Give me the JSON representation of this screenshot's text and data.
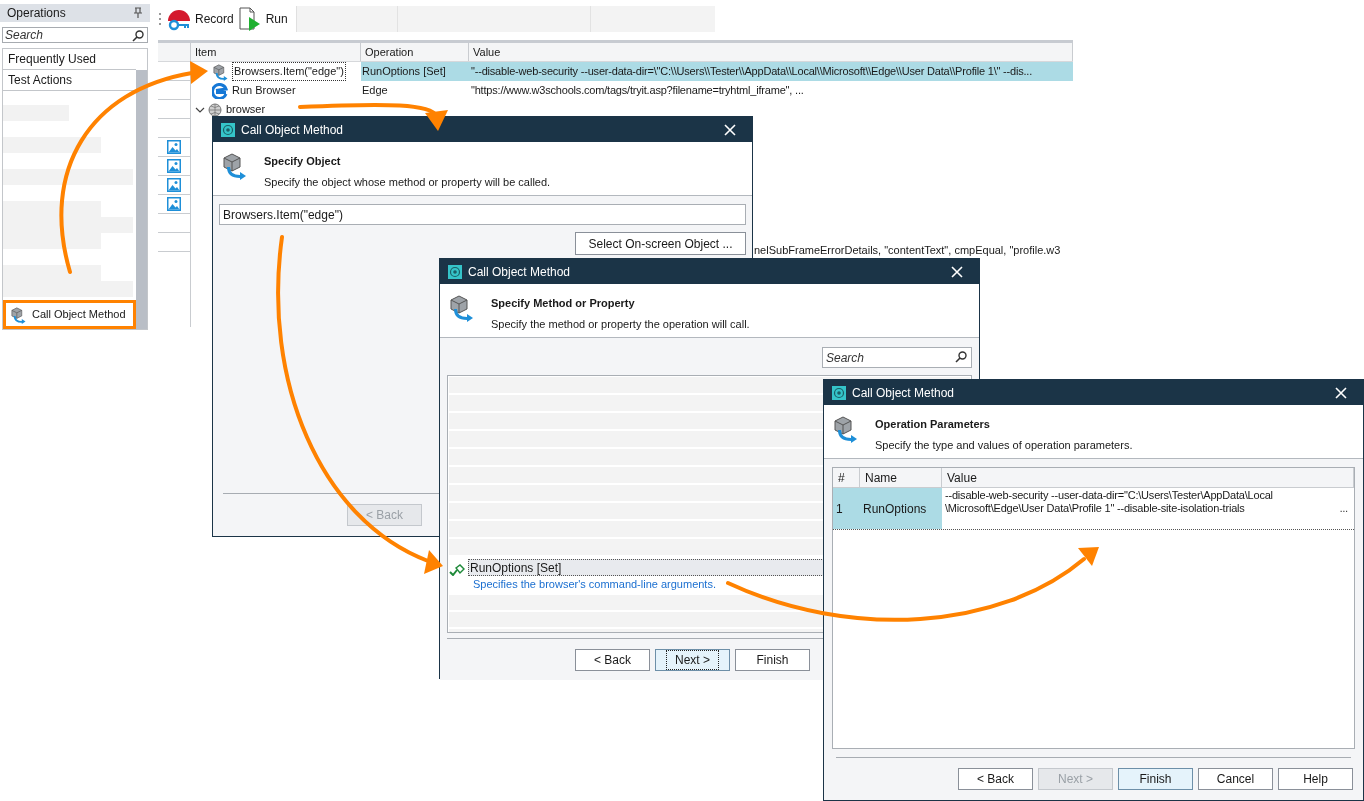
{
  "operations_panel": {
    "title": "Operations",
    "search": {
      "placeholder": "Search"
    },
    "categories": [
      {
        "label": "Frequently Used"
      },
      {
        "label": "Test Actions"
      }
    ],
    "items": [
      {
        "label": "Call Object Method",
        "selected": true
      }
    ]
  },
  "toolbar": {
    "buttons": [
      {
        "label": "Record",
        "kind": "record"
      },
      {
        "label": "Run",
        "kind": "run"
      }
    ]
  },
  "test_grid": {
    "columns": [
      "Item",
      "Operation",
      "Value"
    ],
    "rows": [
      {
        "kind": "object",
        "item": "Browsers.Item(\"edge\")",
        "operation": "RunOptions [Set]",
        "value": "\"--disable-web-security --user-data-dir=\\\"C:\\\\Users\\\\Tester\\\\AppData\\\\Local\\\\Microsoft\\\\Edge\\\\User Data\\\\Profile 1\\\" --dis...",
        "selected": true
      },
      {
        "kind": "edge",
        "item": "Run Browser",
        "operation": "Edge",
        "value": "\"https://www.w3schools.com/tags/tryit.asp?filename=tryhtml_iframe\", ...",
        "selected": false
      },
      {
        "kind": "globe",
        "item": "browser",
        "expanded": true,
        "selected": false
      }
    ],
    "covered_rows": [
      {
        "image": false
      },
      {
        "image": true
      },
      {
        "image": true
      },
      {
        "image": true
      },
      {
        "image": true
      },
      {
        "image": false
      },
      {
        "image": false
      }
    ],
    "cut_off_text": "nelSubFrameErrorDetails, \"contentText\", cmpEqual, \"profile.w3"
  },
  "dialogs": [
    {
      "kind": "specify_object",
      "title": "Call Object Method",
      "step_title": "Specify Object",
      "step_description": "Specify the object whose method or property will be called.",
      "object_value": "Browsers.Item(\"edge\")",
      "pick_button": "Select On-screen Object ...",
      "buttons": [
        {
          "label": "< Back",
          "disabled": true,
          "focused": false
        }
      ]
    },
    {
      "kind": "specify_method",
      "title": "Call Object Method",
      "step_title": "Specify Method or Property",
      "step_description": "Specify the method or property the operation will call.",
      "search": {
        "placeholder": "Search"
      },
      "members": [
        {
          "name": "RunOptions [Set]",
          "description": "Specifies the browser's command-line arguments.",
          "selected": true
        }
      ],
      "buttons": [
        {
          "label": "< Back",
          "disabled": false,
          "focused": false
        },
        {
          "label": "Next >",
          "disabled": false,
          "focused": true
        },
        {
          "label": "Finish",
          "disabled": false,
          "focused": false
        }
      ]
    },
    {
      "kind": "operation_parameters",
      "title": "Call Object Method",
      "step_title": "Operation Parameters",
      "step_description": "Specify the type and values of operation parameters.",
      "columns": [
        "#",
        "Name",
        "Value"
      ],
      "parameters": [
        {
          "number": "1",
          "name": "RunOptions",
          "value_lines": [
            "--disable-web-security --user-data-dir=\"C:\\Users\\Tester\\AppData\\Local",
            "\\Microsoft\\Edge\\User Data\\Profile 1\" --disable-site-isolation-trials"
          ],
          "ellipsis": "...",
          "selected": true
        }
      ],
      "buttons": [
        {
          "label": "< Back",
          "disabled": false,
          "focused": false
        },
        {
          "label": "Next >",
          "disabled": true,
          "focused": false
        },
        {
          "label": "Finish",
          "disabled": false,
          "focused": true
        },
        {
          "label": "Cancel",
          "disabled": false,
          "focused": false
        },
        {
          "label": "Help",
          "disabled": false,
          "focused": false
        }
      ]
    }
  ]
}
